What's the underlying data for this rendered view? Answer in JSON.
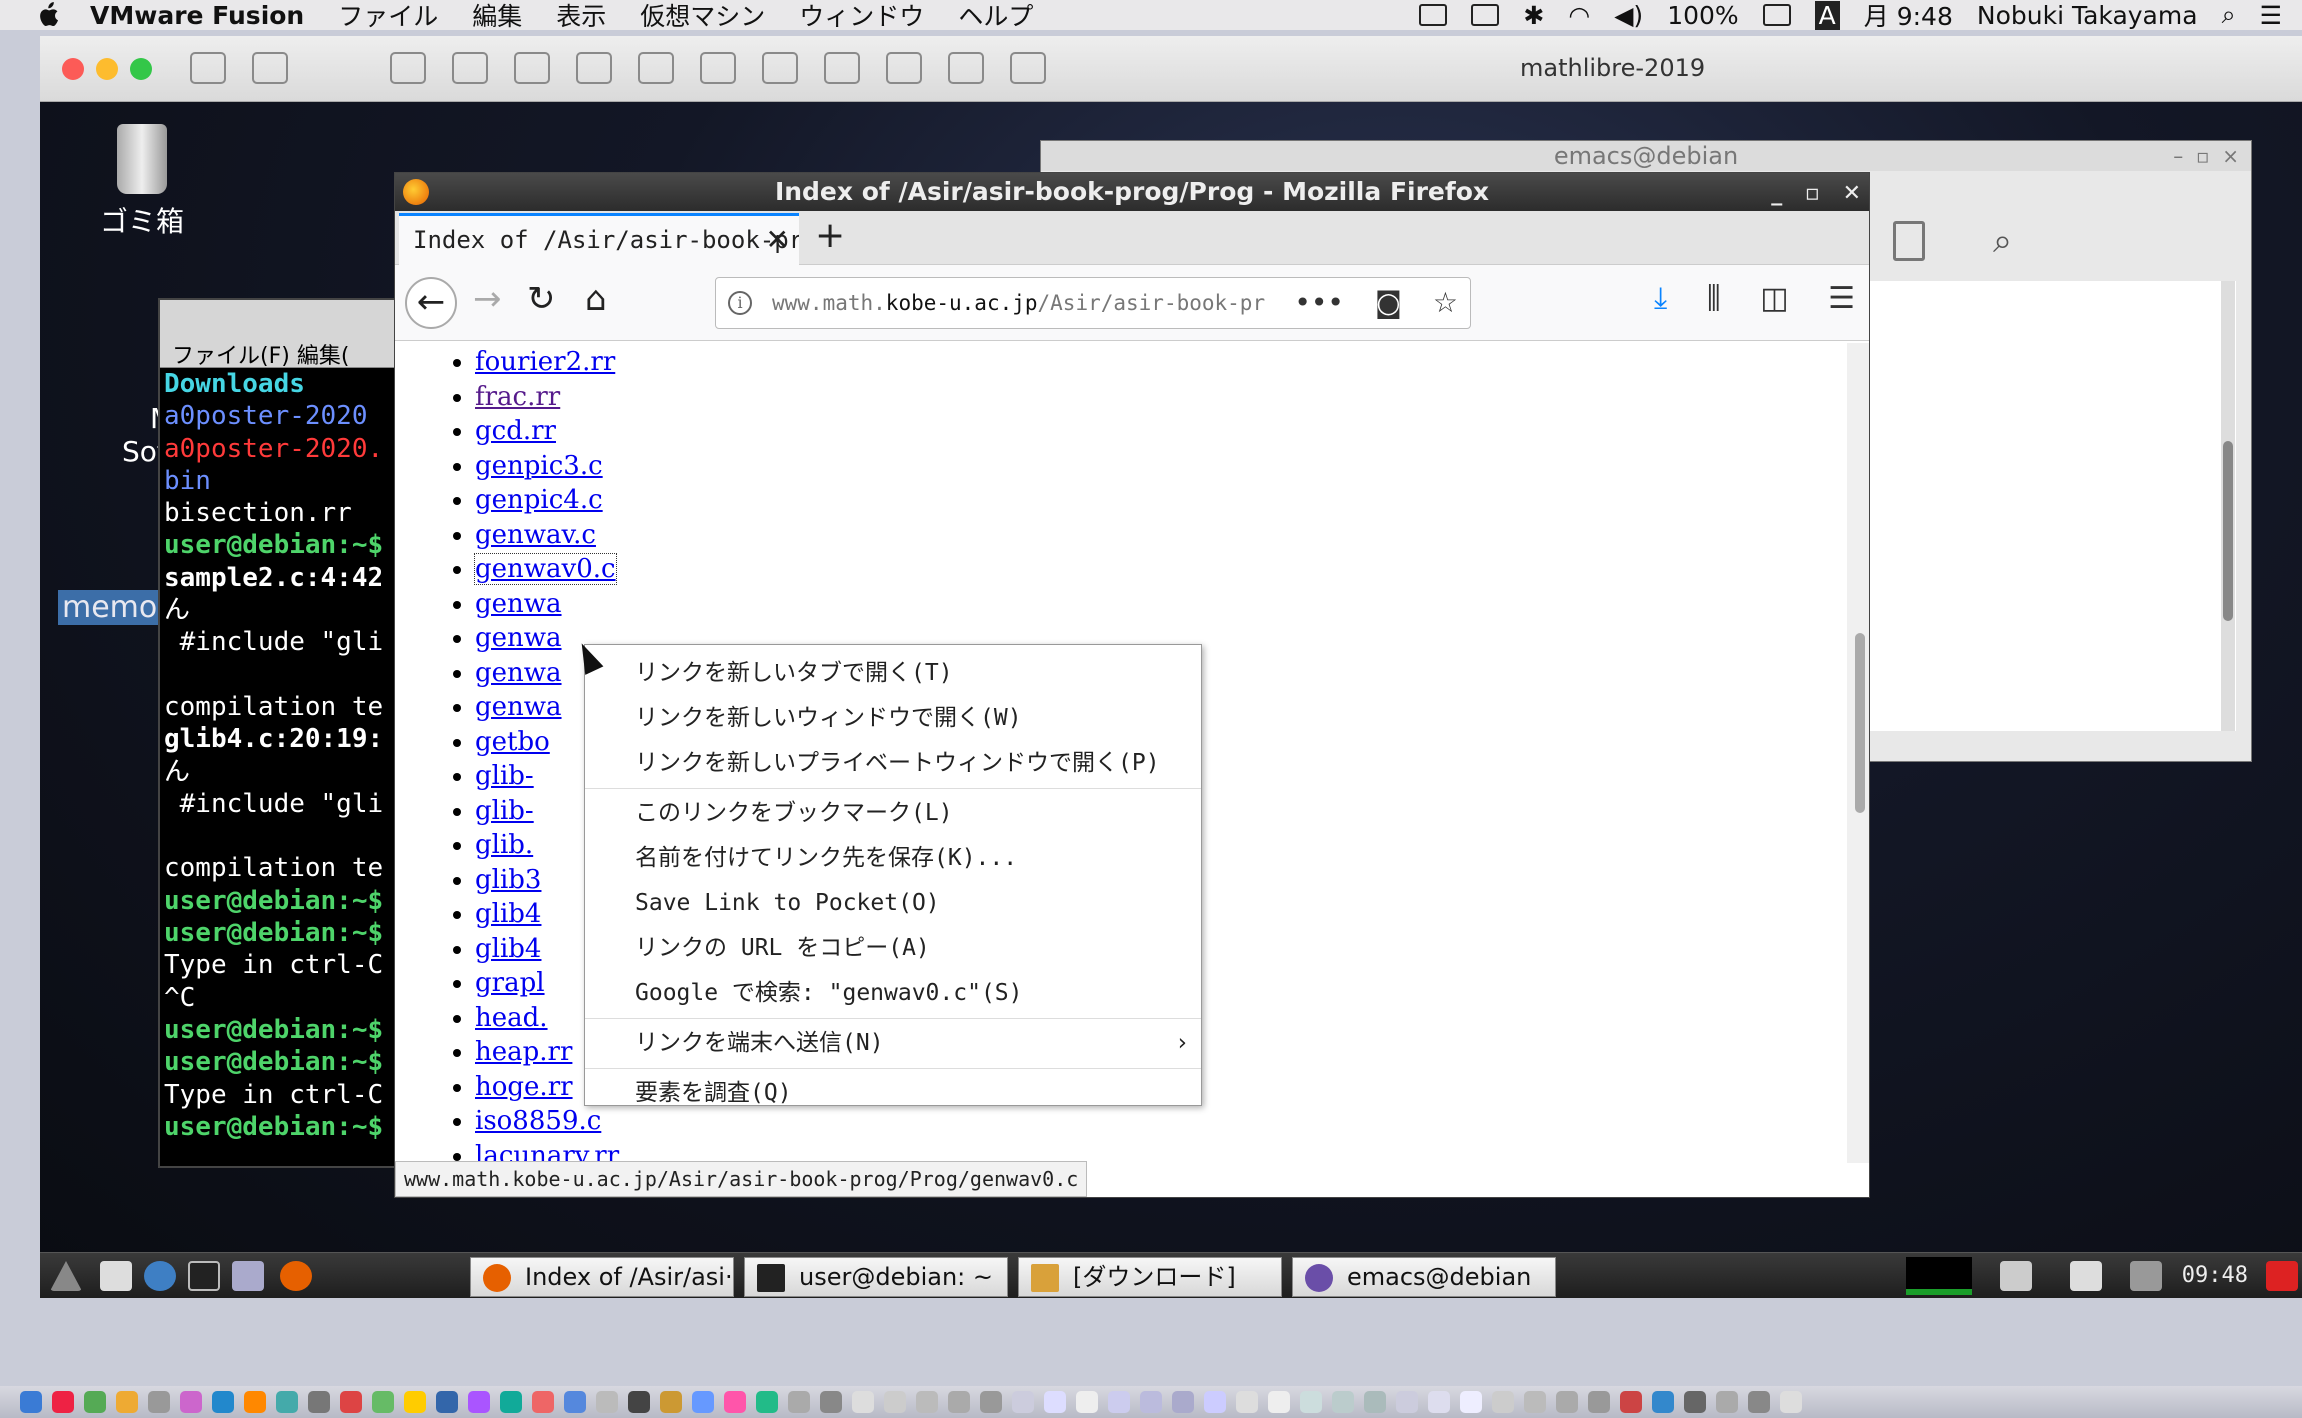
{
  "mac_menubar": {
    "app_name": "VMware Fusion",
    "menus": [
      "ファイル",
      "編集",
      "表示",
      "仮想マシン",
      "ウィンドウ",
      "ヘルプ"
    ],
    "battery": "100%",
    "clock": "月 9:48",
    "user": "Nobuki Takayama",
    "input_indicator": "A"
  },
  "vmware": {
    "window_title": "mathlibre-2019"
  },
  "desktop": {
    "trash_label": "ゴミ箱",
    "icon2_label_line1": "Ma",
    "icon2_label_line2": "Softw",
    "memo_label": "memo"
  },
  "terminal": {
    "menu": "ファイル(F)  編集(",
    "lines": [
      {
        "text": "Downloads",
        "style": "t-cyan"
      },
      {
        "text": "a0poster-2020",
        "style": "t-blue"
      },
      {
        "text": "a0poster-2020.",
        "style": "t-red"
      },
      {
        "text": "bin",
        "style": "t-blue"
      },
      {
        "text": "bisection.rr",
        "style": ""
      },
      {
        "text": "user@debian:~$",
        "style": "t-green"
      },
      {
        "text": "sample2.c:4:42",
        "style": "t-bold"
      },
      {
        "text": "ん",
        "style": ""
      },
      {
        "text": " #include \"gli",
        "style": ""
      },
      {
        "text": "",
        "style": ""
      },
      {
        "text": "compilation te",
        "style": ""
      },
      {
        "text": "glib4.c:20:19:",
        "style": "t-bold"
      },
      {
        "text": "ん",
        "style": ""
      },
      {
        "text": " #include \"gli",
        "style": ""
      },
      {
        "text": "",
        "style": ""
      },
      {
        "text": "compilation te",
        "style": ""
      },
      {
        "text": "user@debian:~$",
        "style": "t-green"
      },
      {
        "text": "user@debian:~$",
        "style": "t-green"
      },
      {
        "text": "Type in ctrl-C",
        "style": ""
      },
      {
        "text": "^C",
        "style": ""
      },
      {
        "text": "user@debian:~$",
        "style": "t-green"
      },
      {
        "text": "user@debian:~$",
        "style": "t-green"
      },
      {
        "text": "Type in ctrl-C",
        "style": ""
      },
      {
        "text": "user@debian:~$",
        "style": "t-green"
      }
    ]
  },
  "emacs": {
    "title": "emacs@debian"
  },
  "firefox": {
    "window_title": "Index of /Asir/asir-book-prog/Prog - Mozilla Firefox",
    "tab_title": "Index of /Asir/asir-book-pr",
    "url_prefix": "www.math.",
    "url_domain": "kobe-u.ac.jp",
    "url_suffix": "/Asir/asir-book-pr",
    "status_url": "www.math.kobe-u.ac.jp/Asir/asir-book-prog/Prog/genwav0.c",
    "files": [
      {
        "name": "fourier2.rr",
        "state": ""
      },
      {
        "name": "frac.rr",
        "state": "visited"
      },
      {
        "name": "gcd.rr",
        "state": ""
      },
      {
        "name": "genpic3.c",
        "state": ""
      },
      {
        "name": "genpic4.c",
        "state": ""
      },
      {
        "name": "genwav.c",
        "state": ""
      },
      {
        "name": "genwav0.c",
        "state": "focused"
      },
      {
        "name": "genwa",
        "state": ""
      },
      {
        "name": "genwa",
        "state": ""
      },
      {
        "name": "genwa",
        "state": ""
      },
      {
        "name": "genwa",
        "state": ""
      },
      {
        "name": "getbo",
        "state": ""
      },
      {
        "name": "glib-",
        "state": ""
      },
      {
        "name": "glib-",
        "state": ""
      },
      {
        "name": "glib.",
        "state": ""
      },
      {
        "name": "glib3",
        "state": ""
      },
      {
        "name": "glib4",
        "state": ""
      },
      {
        "name": "glib4",
        "state": ""
      },
      {
        "name": "grapl",
        "state": ""
      },
      {
        "name": "head.",
        "state": ""
      },
      {
        "name": "heap.rr",
        "state": ""
      },
      {
        "name": "hoge.rr",
        "state": ""
      },
      {
        "name": "iso8859.c",
        "state": ""
      },
      {
        "name": "lacunary.rr",
        "state": ""
      }
    ]
  },
  "context_menu": {
    "open_new_tab": "リンクを新しいタブで開く(T)",
    "open_new_window": "リンクを新しいウィンドウで開く(W)",
    "open_private": "リンクを新しいプライベートウィンドウで開く(P)",
    "bookmark": "このリンクをブックマーク(L)",
    "save_as": "名前を付けてリンク先を保存(K)...",
    "pocket": "Save Link to Pocket(O)",
    "copy_url": "リンクの URL をコピー(A)",
    "google": "Google で検索: \"genwav0.c\"(S)",
    "send_device": "リンクを端末へ送信(N)",
    "inspect": "要素を調査(Q)"
  },
  "taskbar": {
    "firefox_task": "Index of /Asir/asi···",
    "terminal_task": "user@debian: ~",
    "filemanager_task": "[ダウンロード]",
    "emacs_task": "emacs@debian",
    "clock": "09:48"
  },
  "colors": {
    "link": "#0000ee",
    "visited_link": "#551a8b",
    "tab_accent": "#0a84ff",
    "terminal_green": "#4ed46a"
  }
}
